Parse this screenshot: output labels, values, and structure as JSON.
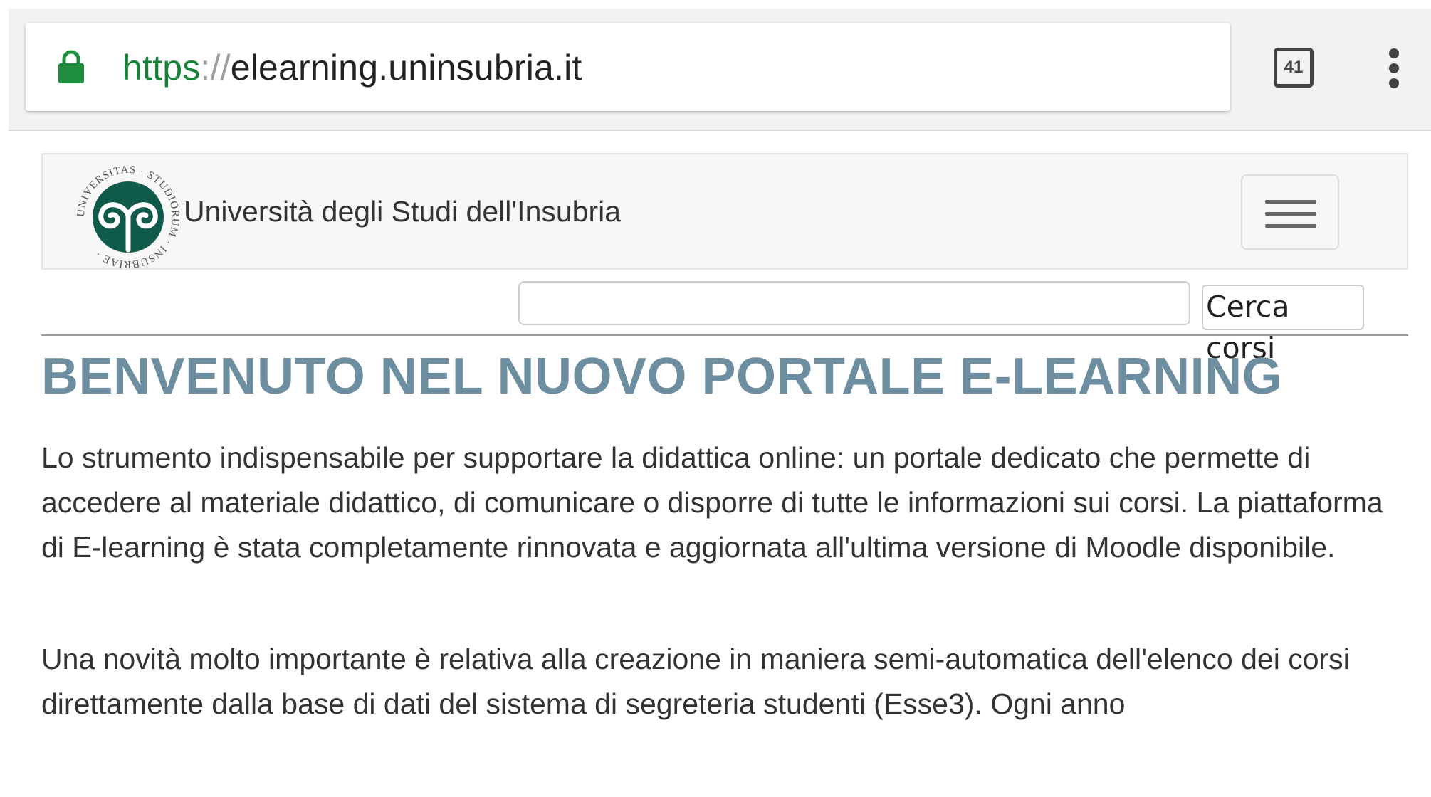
{
  "browser": {
    "url_scheme": "https",
    "url_separator": "://",
    "url_host": "elearning.uninsubria.it",
    "tab_count": "41",
    "lock_color": "#1e8e3e"
  },
  "site": {
    "brand": "Università degli Studi dell'Insubria",
    "logo_text": "UNIVERSITAS · STUDIORUM · INSUBRIAE",
    "logo_color": "#0f5a4a"
  },
  "search": {
    "placeholder": "",
    "button_label": "Cerca corsi"
  },
  "content": {
    "title": "BENVENUTO NEL NUOVO PORTALE E-LEARNING",
    "paragraph1": "Lo strumento indispensabile per supportare la didattica online: un portale dedicato che permette di accedere al materiale didattico, di comunicare o disporre di tutte le informazioni sui corsi. La piattaforma di E-learning è stata completamente rinnovata e aggiornata all'ultima versione di Moodle disponibile.",
    "paragraph2": "Una novità molto importante è relativa alla creazione in maniera semi-automatica dell'elenco dei corsi direttamente dalla base di dati del sistema di segreteria studenti (Esse3). Ogni anno"
  }
}
